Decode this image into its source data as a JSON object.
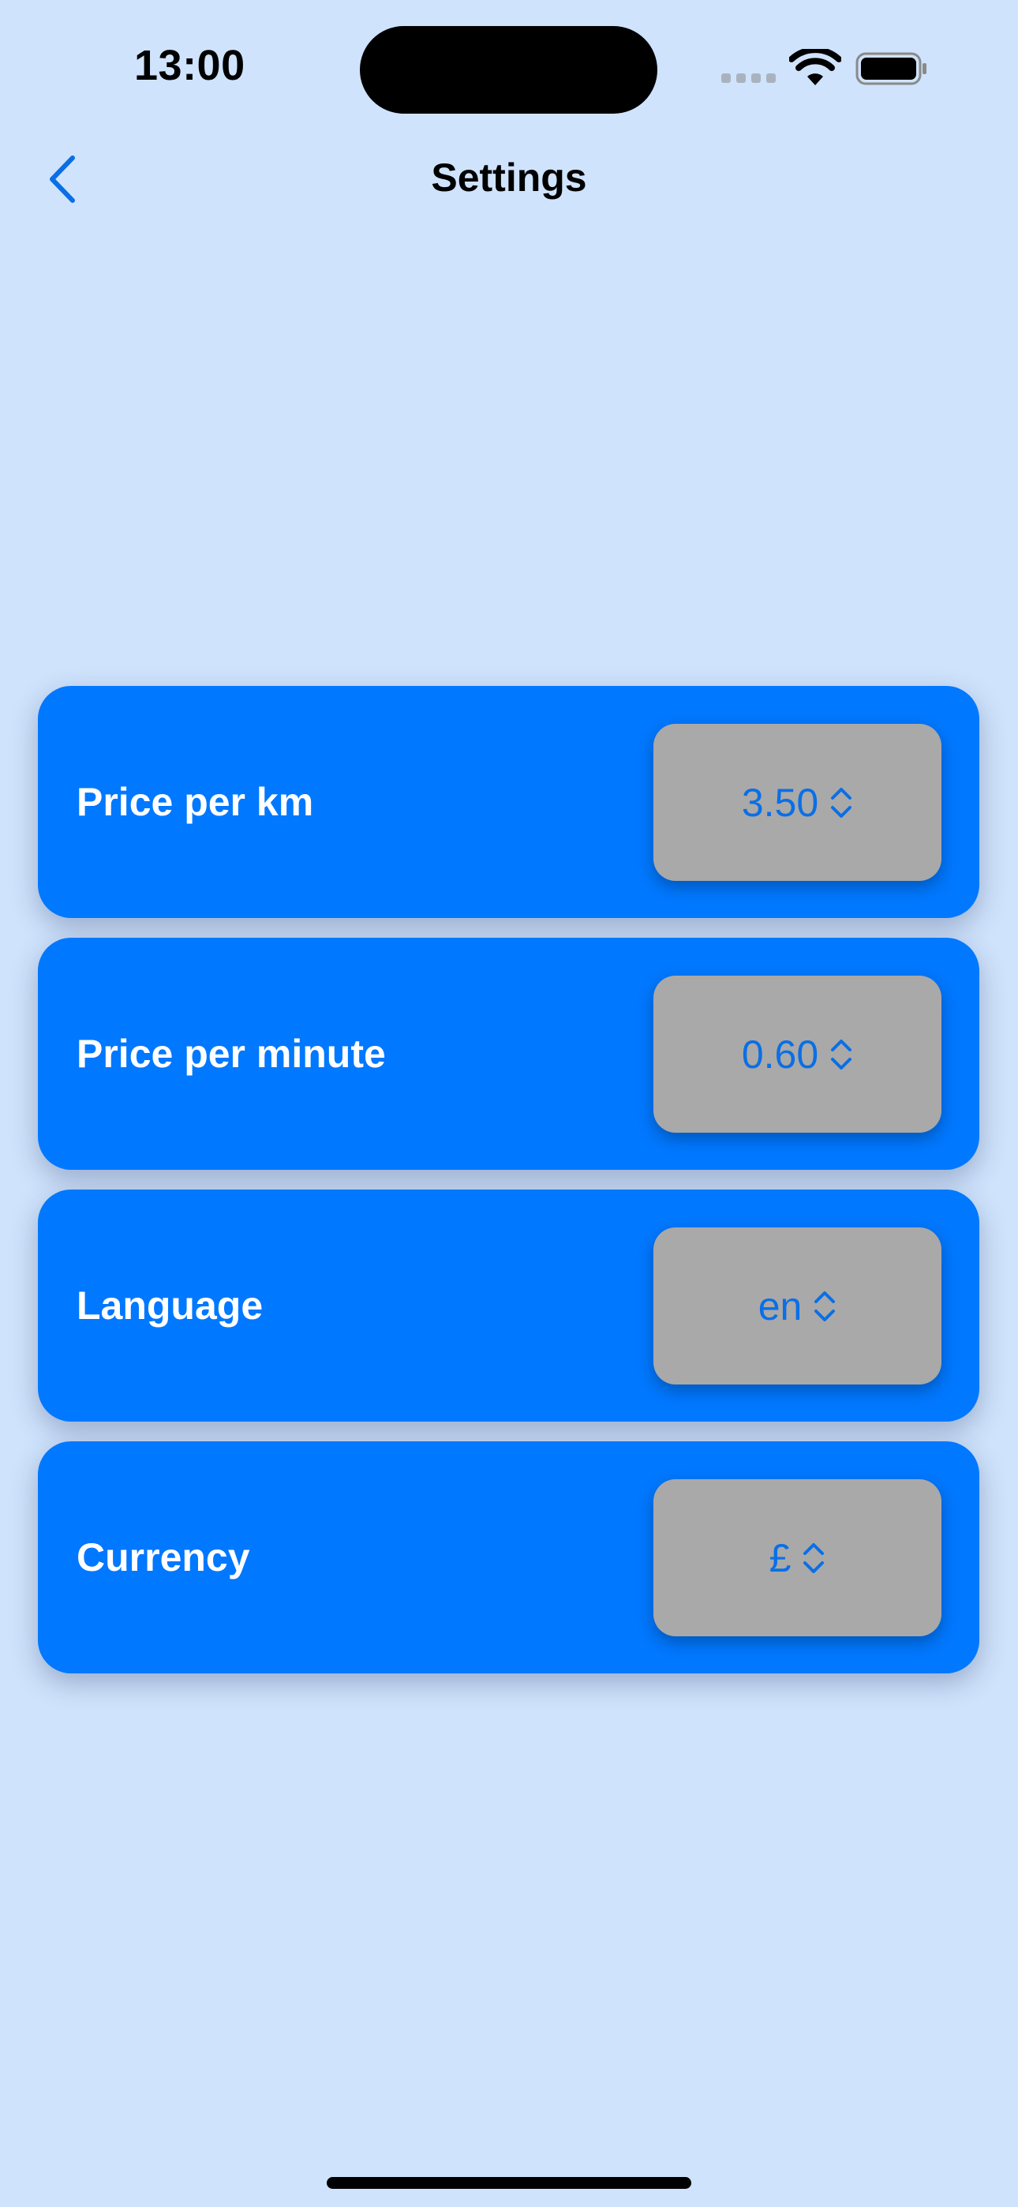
{
  "status_bar": {
    "time": "13:00"
  },
  "nav": {
    "title": "Settings",
    "back_icon": "chevron-left-icon"
  },
  "colors": {
    "background": "#cfe3fc",
    "card": "#0078ff",
    "picker": "#a9a9a9",
    "accent_text": "#0a6fe6"
  },
  "settings": {
    "items": [
      {
        "label": "Price per km",
        "value": "3.50"
      },
      {
        "label": "Price per minute",
        "value": "0.60"
      },
      {
        "label": "Language",
        "value": "en"
      },
      {
        "label": "Currency",
        "value": "£"
      }
    ]
  }
}
